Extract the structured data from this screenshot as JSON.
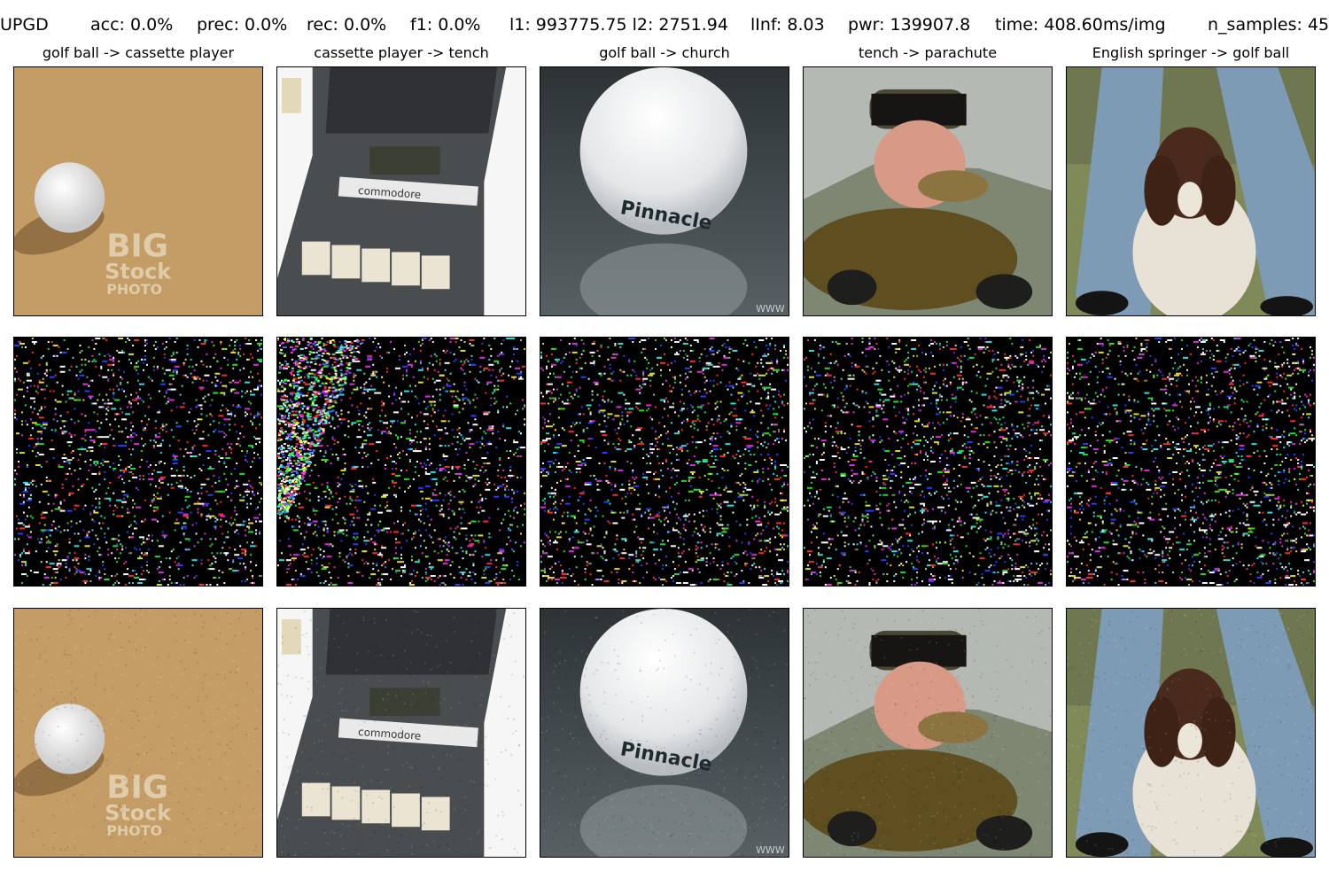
{
  "header": {
    "method": "UPGD",
    "acc": "acc: 0.0%",
    "prec": "prec: 0.0%",
    "rec": "rec: 0.0%",
    "f1": "f1: 0.0%",
    "l1_l2": "l1: 993775.75 l2: 2751.94",
    "linf": "lInf: 8.03",
    "pwr": "pwr: 139907.8",
    "time": "time: 408.60ms/img",
    "n_samples": "n_samples: 45"
  },
  "columns": [
    {
      "title": "golf ball -> cassette player",
      "original": "golf-ball-on-sand",
      "adversarial": "golf-ball-on-sand"
    },
    {
      "title": "cassette player -> tench",
      "original": "commodore-cassette-player",
      "adversarial": "commodore-cassette-player"
    },
    {
      "title": "golf ball -> church",
      "original": "pinnacle-golf-ball",
      "adversarial": "pinnacle-golf-ball"
    },
    {
      "title": "tench -> parachute",
      "original": "man-holding-tench",
      "adversarial": "man-holding-tench"
    },
    {
      "title": "English springer -> golf ball",
      "original": "springer-spaniel-between-legs",
      "adversarial": "springer-spaniel-between-legs"
    }
  ],
  "image_text": {
    "watermark_big": "BIG",
    "watermark_stock": "Stock",
    "watermark_photo": "PHOTO",
    "brand_commodore": "commodore",
    "brand_pinnacle": "Pinnacle",
    "corner_www": "WWW"
  },
  "rows": [
    "original",
    "perturbation",
    "adversarial"
  ]
}
